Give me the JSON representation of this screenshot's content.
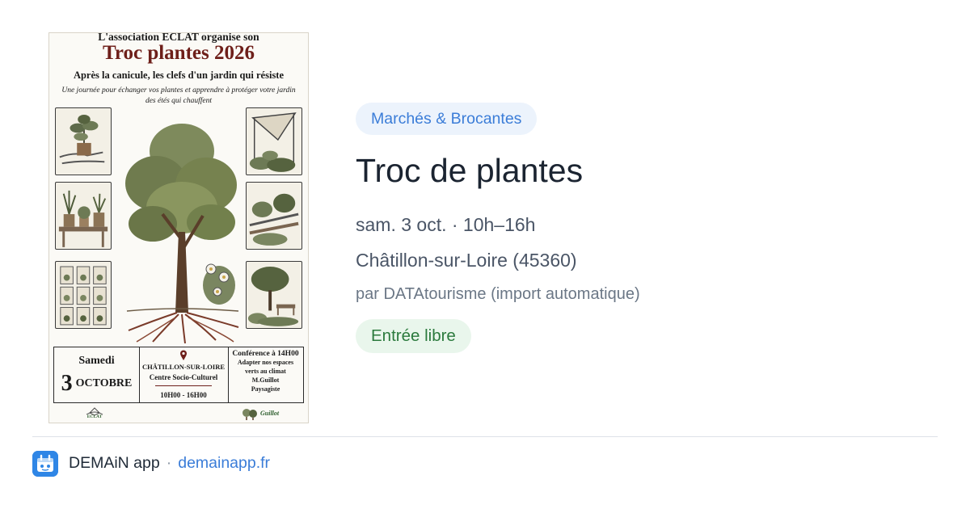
{
  "poster": {
    "top_line": "L'association ECLAT organise son",
    "title": "Troc plantes 2026",
    "subtitle": "Après la canicule, les clefs d'un jardin qui résiste",
    "tagline_1": "Une journée pour échanger vos plantes et apprendre à protéger votre jardin",
    "tagline_2": "des étés qui chauffent",
    "date_day": "Samedi",
    "date_number": "3",
    "date_month": "OCTOBRE",
    "place_city": "CHÂTILLON-SUR-LOIRE",
    "place_centre": "Centre Socio-Culturel",
    "place_hours": "10H00 - 16H00",
    "conference_title": "Conférence à 14H00",
    "conference_line_1": "Adapter nos espaces",
    "conference_line_2": "verts au climat",
    "speaker_name": "M.Guillot",
    "speaker_role": "Paysagiste",
    "logo_left_text": "ECLAT",
    "logo_right_text": "Guillot"
  },
  "event": {
    "category": "Marchés & Brocantes",
    "title": "Troc de plantes",
    "when": "sam. 3 oct. · 10h–16h",
    "where": "Châtillon-sur-Loire (45360)",
    "source": "par DATAtourisme (import automatique)",
    "price_badge": "Entrée libre"
  },
  "footer": {
    "app_name": "DEMAiN app",
    "separator": "·",
    "domain": "demainapp.fr"
  },
  "colors": {
    "category_bg": "#ecf3fc",
    "category_text": "#3b7dd8",
    "badge_bg": "#e9f6ec",
    "badge_text": "#2b7a3d",
    "poster_title": "#6e1f1a",
    "app_icon": "#2f86e6"
  },
  "icons": {
    "app": "demain-app-icon",
    "location": "map-pin-icon"
  }
}
